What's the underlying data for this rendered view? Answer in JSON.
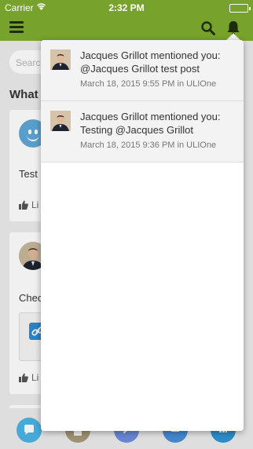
{
  "status_bar": {
    "carrier": "Carrier",
    "time": "2:32 PM",
    "battery_level": 1.0
  },
  "nav_bar": {
    "menu_icon": "hamburger-icon",
    "search_icon": "search-icon",
    "notifications_icon": "bell-icon"
  },
  "feed": {
    "search_placeholder": "Search",
    "section_title": "What",
    "posts": [
      {
        "text": "Test p",
        "like_label": "Li"
      },
      {
        "text": "Chec",
        "like_label": "Li"
      }
    ]
  },
  "notifications": [
    {
      "title": "Jacques Grillot mentioned you: @Jacques Grillot test post",
      "date": "March 18, 2015 9:55 PM",
      "location_prefix": "in",
      "group": "ULIOne"
    },
    {
      "title": "Jacques Grillot mentioned you: Testing @Jacques Grillot",
      "date": "March 18, 2015 9:36 PM",
      "location_prefix": "in",
      "group": "ULIOne"
    }
  ],
  "tab_bar": {
    "tabs": [
      "chat-icon",
      "document-icon",
      "link-icon",
      "list-icon",
      "grid-icon"
    ]
  },
  "colors": {
    "brand": "#77a22b",
    "accent": "#2d8bd3"
  }
}
